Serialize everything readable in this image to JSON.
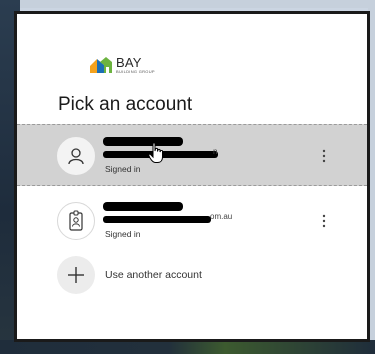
{
  "brand": {
    "name": "BAY",
    "sub": "BUILDING GROUP",
    "colors": [
      "#f4a21d",
      "#1c6fb5",
      "#6cb33f"
    ]
  },
  "title": "Pick an account",
  "accounts": [
    {
      "avatar_icon": "person-icon",
      "status": "Signed in",
      "email_suffix": "n",
      "selected": true,
      "more_icon": "more-vertical-icon"
    },
    {
      "avatar_icon": "id-badge-icon",
      "status": "Signed in",
      "email_suffix": "om.au",
      "selected": false,
      "more_icon": "more-vertical-icon"
    }
  ],
  "add_account": {
    "label": "Use another account",
    "icon": "plus-icon"
  },
  "cursor": "hand-pointer-icon"
}
